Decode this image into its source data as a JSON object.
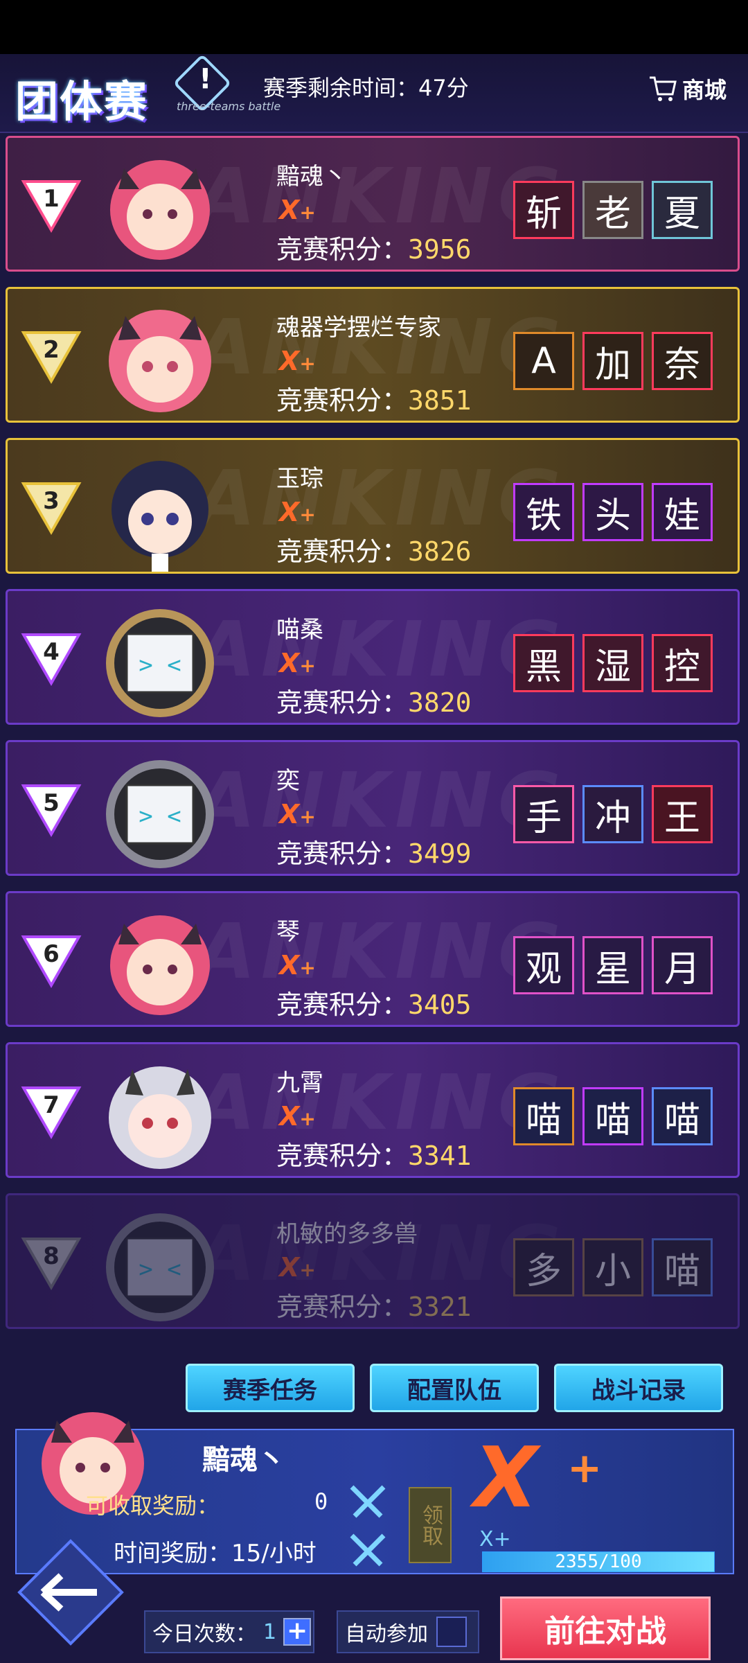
{
  "header": {
    "logo_title": "团体赛",
    "logo_subtitle": "three-teams battle",
    "timer": "赛季剩余时间：47分",
    "shop_label": "商城"
  },
  "rows": [
    {
      "rank": "1",
      "name": "黯魂丶",
      "tier": "X",
      "score_label": "竞赛积分：",
      "score": "3956",
      "tags": [
        "斩",
        "老",
        "夏"
      ]
    },
    {
      "rank": "2",
      "name": "魂器学摆烂专家",
      "tier": "X",
      "score_label": "竞赛积分：",
      "score": "3851",
      "tags": [
        "A",
        "加",
        "奈"
      ]
    },
    {
      "rank": "3",
      "name": "玉琮",
      "tier": "X",
      "score_label": "竞赛积分：",
      "score": "3826",
      "tags": [
        "铁",
        "头",
        "娃"
      ]
    },
    {
      "rank": "4",
      "name": "喵桑",
      "tier": "X",
      "score_label": "竞赛积分：",
      "score": "3820",
      "tags": [
        "黑",
        "湿",
        "控"
      ]
    },
    {
      "rank": "5",
      "name": "奕",
      "tier": "X",
      "score_label": "竞赛积分：",
      "score": "3499",
      "tags": [
        "手",
        "冲",
        "王"
      ]
    },
    {
      "rank": "6",
      "name": "琴",
      "tier": "X",
      "score_label": "竞赛积分：",
      "score": "3405",
      "tags": [
        "观",
        "星",
        "月"
      ]
    },
    {
      "rank": "7",
      "name": "九霄",
      "tier": "X",
      "score_label": "竞赛积分：",
      "score": "3341",
      "tags": [
        "喵",
        "喵",
        "喵"
      ]
    },
    {
      "rank": "8",
      "name": "机敏的多多兽",
      "tier": "X",
      "score_label": "竞赛积分：",
      "score": "3321",
      "tags": [
        "多",
        "小",
        "喵"
      ]
    }
  ],
  "deco_text": "RANKING",
  "actions": {
    "tasks": "赛季任务",
    "team": "配置队伍",
    "records": "战斗记录"
  },
  "me": {
    "name": "黯魂丶",
    "reward_label": "可收取奖励：",
    "reward_value": "0",
    "time_label": "时间奖励：15/小时",
    "claim": "领取",
    "tier_big": "X",
    "tier_name": "X+",
    "progress": "2355/100"
  },
  "bottom": {
    "today_label": "今日次数：",
    "today_count": "1",
    "plus": "+",
    "auto_label": "自动参加",
    "battle": "前往对战"
  },
  "icons": {
    "back": "back-arrow-icon",
    "shop": "cart-icon",
    "sword": "crossed-swords-icon"
  }
}
